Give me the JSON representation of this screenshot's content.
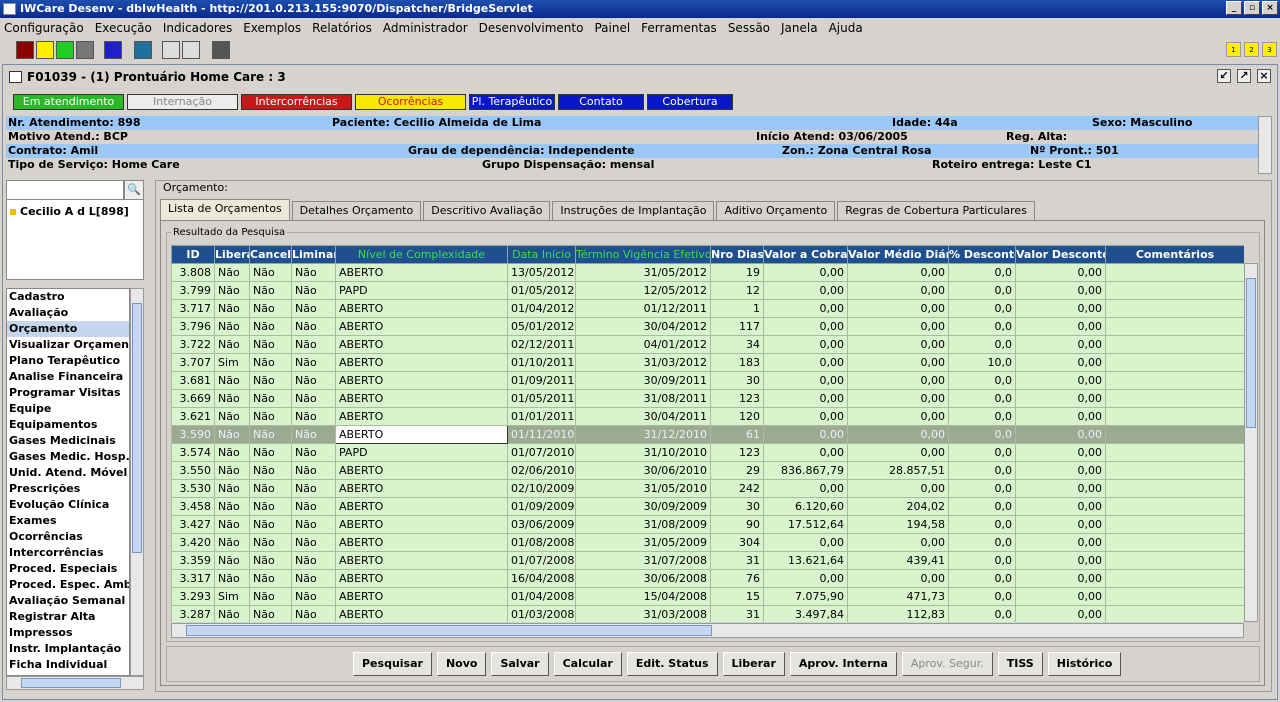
{
  "window": {
    "title": "IWCare Desenv - dbIwHealth - http://201.0.213.155:9070/Dispatcher/BridgeServlet"
  },
  "menu": [
    "Configuração",
    "Execução",
    "Indicadores",
    "Exemplos",
    "Relatórios",
    "Administrador",
    "Desenvolvimento",
    "Painel",
    "Ferramentas",
    "Sessão",
    "Janela",
    "Ajuda"
  ],
  "toolbar_right": [
    "1",
    "2",
    "3"
  ],
  "frame": {
    "title": "F01039 - (1) Prontuário Home Care : 3"
  },
  "status_tabs": [
    {
      "label": "Em atendimento",
      "bg": "#28b828",
      "fg": "#ffffff"
    },
    {
      "label": "Internação",
      "bg": "#ececec",
      "fg": "#888888"
    },
    {
      "label": "Intercorrências",
      "bg": "#c81818",
      "fg": "#ffffff"
    },
    {
      "label": "Ocorrências",
      "bg": "#f8e800",
      "fg": "#c81818"
    },
    {
      "label": "Pl. Terapêutico",
      "bg": "#0818c8",
      "fg": "#ffffff"
    },
    {
      "label": "Contato",
      "bg": "#0818c8",
      "fg": "#ffffff"
    },
    {
      "label": "Cobertura",
      "bg": "#0818c8",
      "fg": "#ffffff"
    }
  ],
  "patient": {
    "nr_atendimento": "Nr. Atendimento: 898",
    "paciente": "Paciente: Cecilio Almeida de Lima",
    "idade": "Idade: 44a",
    "sexo": "Sexo: Masculino",
    "motivo": "Motivo Atend.: BCP",
    "inicio": "Início Atend: 03/06/2005",
    "reg_alta": "Reg. Alta:",
    "contrato": "Contrato: Amil",
    "grau": "Grau de dependência: Independente",
    "zona": "Zon.: Zona Central Rosa",
    "pront": "Nº Pront.: 501",
    "tipo": "Tipo de Serviço: Home Care",
    "grupo": "Grupo Dispensação: mensal",
    "roteiro": "Roteiro entrega: Leste C1"
  },
  "tree": {
    "item": "Cecilio A d L[898]"
  },
  "nav": [
    "Cadastro",
    "Avaliação",
    "Orçamento",
    "Visualizar Orçamento",
    "Plano Terapêutico",
    "Analise Financeira",
    "Programar Visitas",
    "Equipe",
    "Equipamentos",
    "Gases Medicinais",
    "Gases Medic. Hosp.",
    "Unid. Atend. Móvel",
    "Prescrições",
    "Evolução Clínica",
    "Exames",
    "Ocorrências",
    "Intercorrências",
    "Proced. Especiais",
    "Proced. Espec. Amb.",
    "Avaliação Semanal",
    "Registrar Alta",
    "Impressos",
    "Instr. Implantação",
    "Ficha Individual"
  ],
  "nav_selected": "Orçamento",
  "panel": {
    "label": "Orçamento:",
    "group_label": "Resultado da Pesquisa"
  },
  "tabs": [
    "Lista de Orçamentos",
    "Detalhes Orçamento",
    "Descritivo Avaliação",
    "Instruções de Implantação",
    "Aditivo Orçamento",
    "Regras de Cobertura Particulares"
  ],
  "columns": [
    "ID",
    "Libera",
    "Cancela",
    "Liminar",
    "Nível de Complexidade",
    "Data Início",
    "Término Vigência Efetivo",
    "Nro Dias",
    "Valor a Cobrar",
    "Valor Médio Diária",
    "% Desconto",
    "Valor Desconto",
    "Comentários"
  ],
  "rows": [
    [
      "3.808",
      "Não",
      "Não",
      "Não",
      "ABERTO",
      "13/05/2012",
      "31/05/2012",
      "19",
      "0,00",
      "0,00",
      "0,0",
      "0,00",
      ""
    ],
    [
      "3.799",
      "Não",
      "Não",
      "Não",
      "PAPD",
      "01/05/2012",
      "12/05/2012",
      "12",
      "0,00",
      "0,00",
      "0,0",
      "0,00",
      ""
    ],
    [
      "3.717",
      "Não",
      "Não",
      "Não",
      "ABERTO",
      "01/04/2012",
      "01/12/2011",
      "1",
      "0,00",
      "0,00",
      "0,0",
      "0,00",
      ""
    ],
    [
      "3.796",
      "Não",
      "Não",
      "Não",
      "ABERTO",
      "05/01/2012",
      "30/04/2012",
      "117",
      "0,00",
      "0,00",
      "0,0",
      "0,00",
      ""
    ],
    [
      "3.722",
      "Não",
      "Não",
      "Não",
      "ABERTO",
      "02/12/2011",
      "04/01/2012",
      "34",
      "0,00",
      "0,00",
      "0,0",
      "0,00",
      ""
    ],
    [
      "3.707",
      "Sim",
      "Não",
      "Não",
      "ABERTO",
      "01/10/2011",
      "31/03/2012",
      "183",
      "0,00",
      "0,00",
      "10,0",
      "0,00",
      ""
    ],
    [
      "3.681",
      "Não",
      "Não",
      "Não",
      "ABERTO",
      "01/09/2011",
      "30/09/2011",
      "30",
      "0,00",
      "0,00",
      "0,0",
      "0,00",
      ""
    ],
    [
      "3.669",
      "Não",
      "Não",
      "Não",
      "ABERTO",
      "01/05/2011",
      "31/08/2011",
      "123",
      "0,00",
      "0,00",
      "0,0",
      "0,00",
      ""
    ],
    [
      "3.621",
      "Não",
      "Não",
      "Não",
      "ABERTO",
      "01/01/2011",
      "30/04/2011",
      "120",
      "0,00",
      "0,00",
      "0,0",
      "0,00",
      ""
    ],
    [
      "3.590",
      "Não",
      "Não",
      "Não",
      "ABERTO",
      "01/11/2010",
      "31/12/2010",
      "61",
      "0,00",
      "0,00",
      "0,0",
      "0,00",
      ""
    ],
    [
      "3.574",
      "Não",
      "Não",
      "Não",
      "PAPD",
      "01/07/2010",
      "31/10/2010",
      "123",
      "0,00",
      "0,00",
      "0,0",
      "0,00",
      ""
    ],
    [
      "3.550",
      "Não",
      "Não",
      "Não",
      "ABERTO",
      "02/06/2010",
      "30/06/2010",
      "29",
      "836.867,79",
      "28.857,51",
      "0,0",
      "0,00",
      ""
    ],
    [
      "3.530",
      "Não",
      "Não",
      "Não",
      "ABERTO",
      "02/10/2009",
      "31/05/2010",
      "242",
      "0,00",
      "0,00",
      "0,0",
      "0,00",
      ""
    ],
    [
      "3.458",
      "Não",
      "Não",
      "Não",
      "ABERTO",
      "01/09/2009",
      "30/09/2009",
      "30",
      "6.120,60",
      "204,02",
      "0,0",
      "0,00",
      ""
    ],
    [
      "3.427",
      "Não",
      "Não",
      "Não",
      "ABERTO",
      "03/06/2009",
      "31/08/2009",
      "90",
      "17.512,64",
      "194,58",
      "0,0",
      "0,00",
      ""
    ],
    [
      "3.420",
      "Não",
      "Não",
      "Não",
      "ABERTO",
      "01/08/2008",
      "31/05/2009",
      "304",
      "0,00",
      "0,00",
      "0,0",
      "0,00",
      ""
    ],
    [
      "3.359",
      "Não",
      "Não",
      "Não",
      "ABERTO",
      "01/07/2008",
      "31/07/2008",
      "31",
      "13.621,64",
      "439,41",
      "0,0",
      "0,00",
      ""
    ],
    [
      "3.317",
      "Não",
      "Não",
      "Não",
      "ABERTO",
      "16/04/2008",
      "30/06/2008",
      "76",
      "0,00",
      "0,00",
      "0,0",
      "0,00",
      ""
    ],
    [
      "3.293",
      "Sim",
      "Não",
      "Não",
      "ABERTO",
      "01/04/2008",
      "15/04/2008",
      "15",
      "7.075,90",
      "471,73",
      "0,0",
      "0,00",
      ""
    ],
    [
      "3.287",
      "Não",
      "Não",
      "Não",
      "ABERTO",
      "01/03/2008",
      "31/03/2008",
      "31",
      "3.497,84",
      "112,83",
      "0,0",
      "0,00",
      ""
    ]
  ],
  "selected_row": 9,
  "buttons": [
    {
      "label": "Pesquisar",
      "enabled": true
    },
    {
      "label": "Novo",
      "enabled": true
    },
    {
      "label": "Salvar",
      "enabled": true
    },
    {
      "label": "Calcular",
      "enabled": true
    },
    {
      "label": "Edit. Status",
      "enabled": true
    },
    {
      "label": "Liberar",
      "enabled": true
    },
    {
      "label": "Aprov. Interna",
      "enabled": true
    },
    {
      "label": "Aprov. Segur.",
      "enabled": false
    },
    {
      "label": "TISS",
      "enabled": true
    },
    {
      "label": "Histórico",
      "enabled": true
    }
  ]
}
